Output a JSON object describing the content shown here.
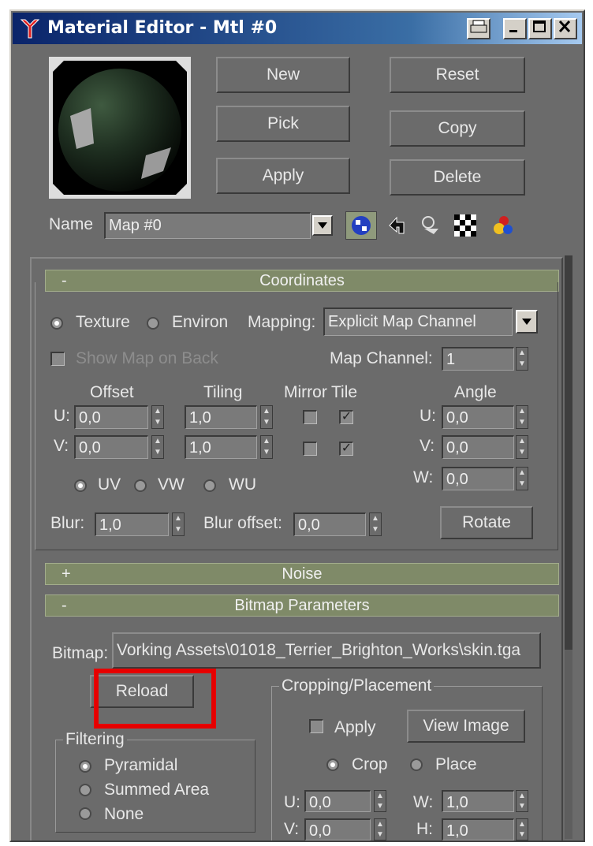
{
  "window": {
    "title": "Material Editor - Mtl #0",
    "titlebar_buttons": [
      "print",
      "minimize",
      "maximize",
      "close"
    ]
  },
  "toolbar": {
    "new_label": "New",
    "pick_label": "Pick",
    "apply_label": "Apply",
    "reset_label": "Reset",
    "copy_label": "Copy",
    "delete_label": "Delete"
  },
  "name_row": {
    "label": "Name",
    "value": "Map #0",
    "icons": [
      "map-type-icon",
      "go-to-parent-icon",
      "go-forward-icon",
      "show-background-icon",
      "map-properties-icon"
    ]
  },
  "coordinates": {
    "title": "Coordinates",
    "sign": "-",
    "texture_label": "Texture",
    "environ_label": "Environ",
    "selected_source": "Texture",
    "mapping_label": "Mapping:",
    "mapping_value": "Explicit Map Channel",
    "show_map_on_back_label": "Show Map on Back",
    "show_map_on_back_checked": true,
    "map_channel_label": "Map Channel:",
    "map_channel_value": "1",
    "offset_label": "Offset",
    "tiling_label": "Tiling",
    "mirror_label": "Mirror",
    "tile_label": "Tile",
    "angle_label": "Angle",
    "u_label": "U:",
    "v_label": "V:",
    "w_label": "W:",
    "offset_u": "0,0",
    "offset_v": "0,0",
    "tiling_u": "1,0",
    "tiling_v": "1,0",
    "mirror_u": false,
    "mirror_v": false,
    "tile_u": true,
    "tile_v": true,
    "angle_u": "0,0",
    "angle_v": "0,0",
    "angle_w": "0,0",
    "uv_label": "UV",
    "vw_label": "VW",
    "wu_label": "WU",
    "selected_plane": "UV",
    "blur_label": "Blur:",
    "blur_value": "1,0",
    "blur_offset_label": "Blur offset:",
    "blur_offset_value": "0,0",
    "rotate_label": "Rotate"
  },
  "noise": {
    "title": "Noise",
    "sign": "+"
  },
  "bitmap_parameters": {
    "title": "Bitmap Parameters",
    "sign": "-",
    "bitmap_label": "Bitmap:",
    "bitmap_path": "Vorking Assets\\01018_Terrier_Brighton_Works\\skin.tga",
    "reload_label": "Reload",
    "filtering_title": "Filtering",
    "pyramidal_label": "Pyramidal",
    "summed_area_label": "Summed Area",
    "none_label": "None",
    "selected_filtering": "Pyramidal",
    "cropping_title": "Cropping/Placement",
    "apply_label": "Apply",
    "apply_checked": false,
    "view_image_label": "View Image",
    "crop_label": "Crop",
    "place_label": "Place",
    "selected_crop_mode": "Crop",
    "u_label": "U:",
    "v_label": "V:",
    "w_label": "W:",
    "h_label": "H:",
    "u_value": "0,0",
    "v_value": "0,0",
    "w_value": "1,0",
    "h_value": "1,0"
  },
  "colors": {
    "panel_bg": "#6b6b6b",
    "rollout_bar": "#7f8a68",
    "highlight": "#e60000",
    "title_gradient_start": "#0a246a"
  }
}
